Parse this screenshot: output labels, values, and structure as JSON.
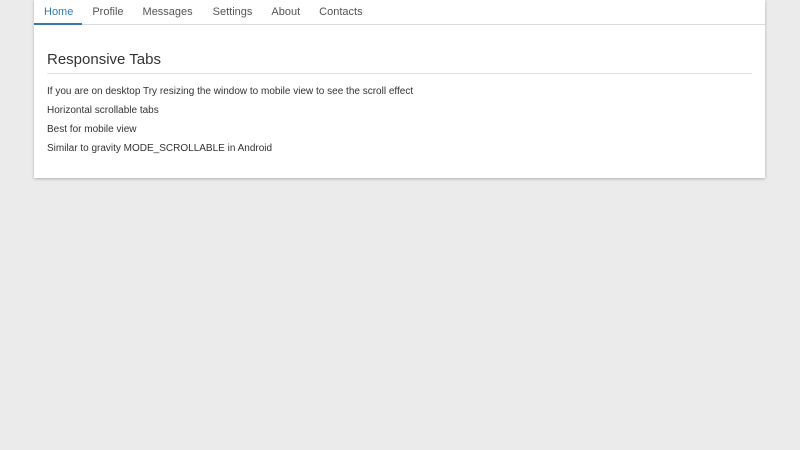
{
  "tabs": [
    {
      "label": "Home",
      "active": true
    },
    {
      "label": "Profile",
      "active": false
    },
    {
      "label": "Messages",
      "active": false
    },
    {
      "label": "Settings",
      "active": false
    },
    {
      "label": "About",
      "active": false
    },
    {
      "label": "Contacts",
      "active": false
    }
  ],
  "main": {
    "title": "Responsive Tabs",
    "paragraphs": [
      "If you are on desktop Try resizing the window to mobile view to see the scroll effect",
      "Horizontal scrollable tabs",
      "Best for mobile view",
      "Similar to gravity MODE_SCROLLABLE in Android"
    ]
  },
  "colors": {
    "accent": "#337ab7",
    "background": "#ebebeb",
    "card": "#ffffff"
  }
}
